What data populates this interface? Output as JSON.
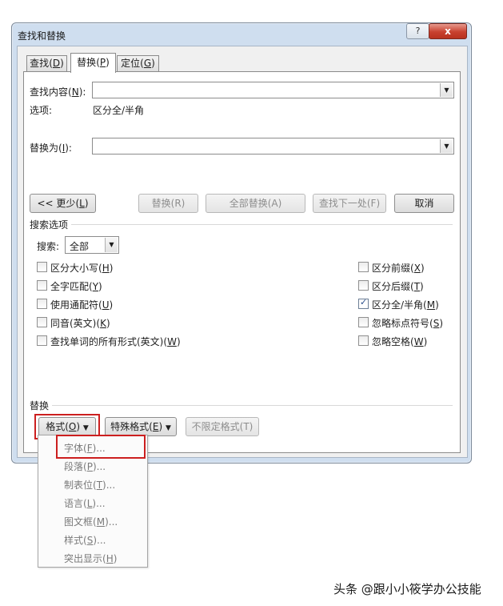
{
  "window": {
    "title": "查找和替换",
    "help_glyph": "?",
    "close_glyph": "x"
  },
  "tabs": [
    {
      "text": "查找",
      "hotkey": "D",
      "active": false
    },
    {
      "text": "替换",
      "hotkey": "P",
      "active": true
    },
    {
      "text": "定位",
      "hotkey": "G",
      "active": false
    }
  ],
  "find": {
    "label": "查找内容",
    "hotkey": "N",
    "value": ""
  },
  "options": {
    "label": "选项:",
    "value": "区分全/半角"
  },
  "replace": {
    "label": "替换为",
    "hotkey": "I",
    "value": ""
  },
  "buttons": {
    "less": {
      "prefix": "<< ",
      "text": "更少",
      "hotkey": "L"
    },
    "replace": "替换(R)",
    "replace_all": "全部替换(A)",
    "find_next": "查找下一处(F)",
    "cancel": "取消"
  },
  "search_options": {
    "heading": "搜索选项",
    "search_label": "搜索",
    "search_value": "全部",
    "left_checks": [
      {
        "text": "区分大小写",
        "hotkey": "H",
        "checked": false
      },
      {
        "text": "全字匹配",
        "hotkey": "Y",
        "checked": false
      },
      {
        "text": "使用通配符",
        "hotkey": "U",
        "checked": false
      },
      {
        "text": "同音(英文)",
        "hotkey": "K",
        "checked": false
      },
      {
        "text": "查找单词的所有形式(英文)",
        "hotkey": "W",
        "checked": false
      }
    ],
    "right_checks": [
      {
        "text": "区分前缀",
        "hotkey": "X",
        "checked": false
      },
      {
        "text": "区分后缀",
        "hotkey": "T",
        "checked": false
      },
      {
        "text": "区分全/半角",
        "hotkey": "M",
        "checked": true
      },
      {
        "text": "忽略标点符号",
        "hotkey": "S",
        "checked": false
      },
      {
        "text": "忽略空格",
        "hotkey": "W",
        "checked": false
      }
    ]
  },
  "replace_section": {
    "heading": "替换",
    "format_btn": {
      "text": "格式",
      "hotkey": "O"
    },
    "special_btn": {
      "text": "特殊格式",
      "hotkey": "E"
    },
    "no_format_btn": "不限定格式(T)"
  },
  "format_menu": [
    {
      "text": "字体",
      "hotkey": "F",
      "suffix": "..."
    },
    {
      "text": "段落",
      "hotkey": "P",
      "suffix": "..."
    },
    {
      "text": "制表位",
      "hotkey": "T",
      "suffix": "..."
    },
    {
      "text": "语言",
      "hotkey": "L",
      "suffix": "..."
    },
    {
      "text": "图文框",
      "hotkey": "M",
      "suffix": "..."
    },
    {
      "text": "样式",
      "hotkey": "S",
      "suffix": "..."
    },
    {
      "text": "突出显示",
      "hotkey": "H",
      "suffix": ""
    }
  ],
  "watermark": "头条 @跟小小筱学办公技能",
  "colors": {
    "highlight": "#cc1f1f",
    "dialog_frame": "#cfdeef",
    "check_mark": "#2c4f8c"
  }
}
